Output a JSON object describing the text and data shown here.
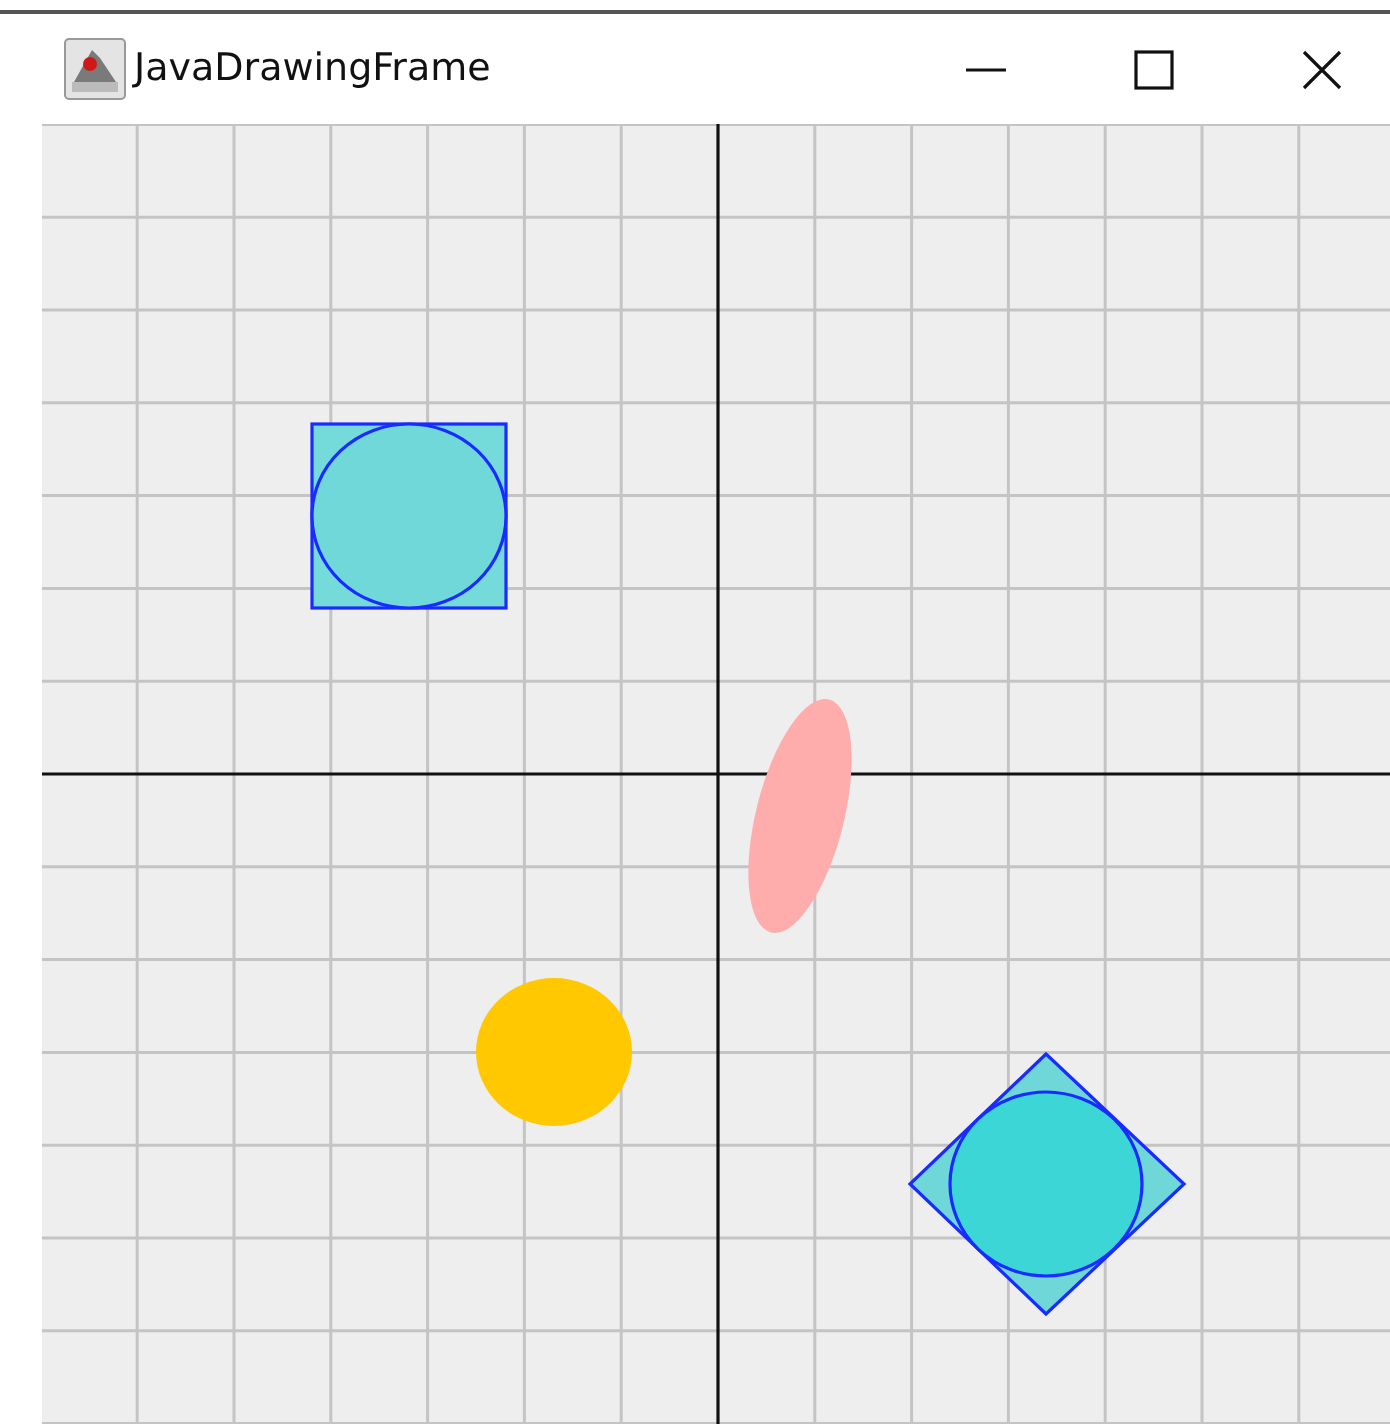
{
  "window": {
    "title": "JavaDrawingFrame"
  }
}
